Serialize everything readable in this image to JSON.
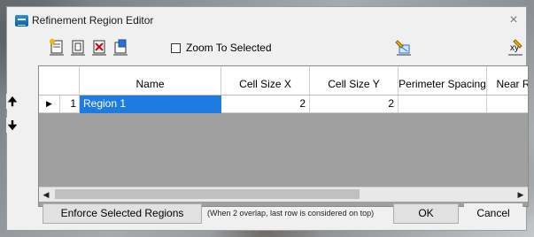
{
  "window": {
    "title": "Refinement Region Editor",
    "close_glyph": "×",
    "app_icon": "grid-editor-icon"
  },
  "toolbar": {
    "buttons": [
      {
        "icon": "new-row-icon"
      },
      {
        "icon": "copy-row-icon"
      },
      {
        "icon": "delete-row-icon"
      },
      {
        "icon": "import-icon"
      }
    ],
    "zoom_label": "Zoom To Selected",
    "zoom_checked": false,
    "right_buttons": [
      {
        "icon": "map-edit-icon"
      },
      {
        "icon": "xy-coordinates-icon"
      }
    ]
  },
  "grid": {
    "columns": [
      "",
      "Name",
      "Cell Size X",
      "Cell Size Y",
      "Perimeter Spacing",
      "Near R"
    ],
    "rows": [
      {
        "indicator": "▶",
        "number": "1",
        "name": "Region 1",
        "cell_size_x": "2",
        "cell_size_y": "2",
        "perimeter_spacing": "",
        "near": ""
      }
    ]
  },
  "side_buttons": {
    "up": "🠉",
    "down": "🠋"
  },
  "bottom": {
    "enforce_label": "Enforce Selected Regions",
    "hint": "(When 2 overlap, last row is considered on top)",
    "ok_label": "OK",
    "cancel_label": "Cancel"
  },
  "colors": {
    "selection": "#1e7ce0",
    "dialog": "#f0f0f0"
  }
}
